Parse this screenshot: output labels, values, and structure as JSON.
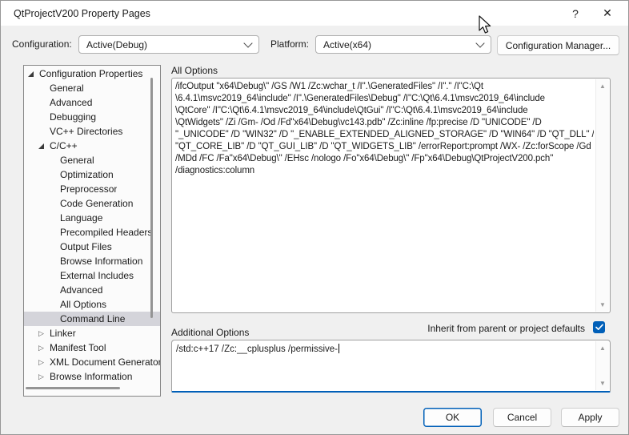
{
  "window": {
    "title": "QtProjectV200 Property Pages",
    "help_label": "?",
    "close_label": "✕"
  },
  "toolbar": {
    "configuration_label": "Configuration:",
    "configuration_value": "Active(Debug)",
    "platform_label": "Platform:",
    "platform_value": "Active(x64)",
    "config_manager_label": "Configuration Manager..."
  },
  "tree": {
    "items": [
      {
        "label": "Configuration Properties",
        "level": 0,
        "state": "expanded",
        "selected": false
      },
      {
        "label": "General",
        "level": 1,
        "state": "leaf",
        "selected": false
      },
      {
        "label": "Advanced",
        "level": 1,
        "state": "leaf",
        "selected": false
      },
      {
        "label": "Debugging",
        "level": 1,
        "state": "leaf",
        "selected": false
      },
      {
        "label": "VC++ Directories",
        "level": 1,
        "state": "leaf",
        "selected": false
      },
      {
        "label": "C/C++",
        "level": 1,
        "state": "expanded",
        "selected": false
      },
      {
        "label": "General",
        "level": 2,
        "state": "leaf",
        "selected": false
      },
      {
        "label": "Optimization",
        "level": 2,
        "state": "leaf",
        "selected": false
      },
      {
        "label": "Preprocessor",
        "level": 2,
        "state": "leaf",
        "selected": false
      },
      {
        "label": "Code Generation",
        "level": 2,
        "state": "leaf",
        "selected": false
      },
      {
        "label": "Language",
        "level": 2,
        "state": "leaf",
        "selected": false
      },
      {
        "label": "Precompiled Headers",
        "level": 2,
        "state": "leaf",
        "selected": false
      },
      {
        "label": "Output Files",
        "level": 2,
        "state": "leaf",
        "selected": false
      },
      {
        "label": "Browse Information",
        "level": 2,
        "state": "leaf",
        "selected": false
      },
      {
        "label": "External Includes",
        "level": 2,
        "state": "leaf",
        "selected": false
      },
      {
        "label": "Advanced",
        "level": 2,
        "state": "leaf",
        "selected": false
      },
      {
        "label": "All Options",
        "level": 2,
        "state": "leaf",
        "selected": false
      },
      {
        "label": "Command Line",
        "level": 2,
        "state": "leaf",
        "selected": true
      },
      {
        "label": "Linker",
        "level": 1,
        "state": "collapsed",
        "selected": false
      },
      {
        "label": "Manifest Tool",
        "level": 1,
        "state": "collapsed",
        "selected": false
      },
      {
        "label": "XML Document Generator",
        "level": 1,
        "state": "collapsed",
        "selected": false
      },
      {
        "label": "Browse Information",
        "level": 1,
        "state": "collapsed",
        "selected": false
      }
    ]
  },
  "main": {
    "all_options_label": "All Options",
    "all_options_lines": [
      "/ifcOutput \"x64\\Debug\\\" /GS /W1 /Zc:wchar_t /I\".\\GeneratedFiles\" /I\".\" /I\"C:\\Qt",
      "\\6.4.1\\msvc2019_64\\include\" /I\".\\GeneratedFiles\\Debug\" /I\"C:\\Qt\\6.4.1\\msvc2019_64\\include",
      "\\QtCore\" /I\"C:\\Qt\\6.4.1\\msvc2019_64\\include\\QtGui\" /I\"C:\\Qt\\6.4.1\\msvc2019_64\\include",
      "\\QtWidgets\" /Zi /Gm- /Od /Fd\"x64\\Debug\\vc143.pdb\" /Zc:inline /fp:precise /D \"UNICODE\" /D",
      "\"_UNICODE\" /D \"WIN32\" /D \"_ENABLE_EXTENDED_ALIGNED_STORAGE\" /D \"WIN64\" /D \"QT_DLL\" /D",
      "\"QT_CORE_LIB\" /D \"QT_GUI_LIB\" /D \"QT_WIDGETS_LIB\" /errorReport:prompt /WX- /Zc:forScope /Gd",
      "/MDd /FC /Fa\"x64\\Debug\\\" /EHsc /nologo /Fo\"x64\\Debug\\\" /Fp\"x64\\Debug\\QtProjectV200.pch\"",
      "/diagnostics:column"
    ],
    "additional_options_label": "Additional Options",
    "inherit_label": "Inherit from parent or project defaults",
    "inherit_checked": true,
    "additional_options_value": "/std:c++17 /Zc:__cplusplus /permissive-"
  },
  "footer": {
    "ok_label": "OK",
    "cancel_label": "Cancel",
    "apply_label": "Apply"
  },
  "colors": {
    "accent": "#005fb8",
    "tree_selection": "#d4d4da",
    "titlebar": "#ffffff",
    "dialog_bg": "#f0f0f0"
  }
}
